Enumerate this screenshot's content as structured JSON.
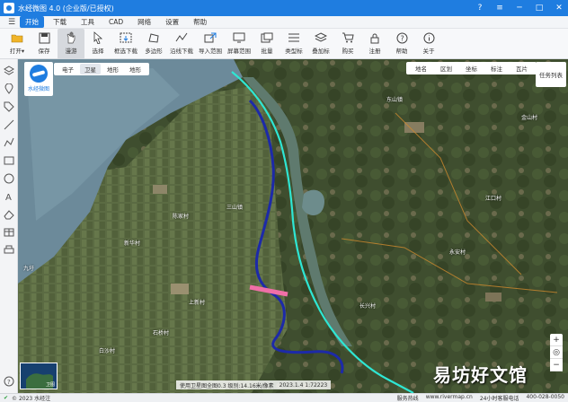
{
  "titlebar": {
    "title": "水经微图 4.0 (企业版/已授权)",
    "app_icon": "map-app-icon"
  },
  "menu": {
    "items": [
      "开始",
      "下载",
      "工具",
      "CAD",
      "网络",
      "设置",
      "帮助"
    ],
    "active": "开始"
  },
  "toolbar": {
    "items": [
      {
        "label": "打开▾",
        "icon": "folder-icon"
      },
      {
        "label": "保存",
        "icon": "save-icon"
      },
      {
        "label": "漫游",
        "icon": "hand-icon"
      },
      {
        "label": "选择",
        "icon": "pointer-icon"
      },
      {
        "label": "框选下载",
        "icon": "box-select-icon"
      },
      {
        "label": "多边形",
        "icon": "polygon-icon"
      },
      {
        "label": "沿线下载",
        "icon": "polyline-icon"
      },
      {
        "label": "导入范围",
        "icon": "import-icon"
      },
      {
        "label": "屏幕范围",
        "icon": "screen-icon"
      },
      {
        "label": "批量",
        "icon": "batch-icon"
      },
      {
        "label": "类型标",
        "icon": "type-icon"
      },
      {
        "label": "叠加标",
        "icon": "overlay-icon"
      },
      {
        "label": "购买",
        "icon": "cart-icon"
      },
      {
        "label": "注册",
        "icon": "lock-icon"
      },
      {
        "label": "帮助",
        "icon": "help-icon"
      },
      {
        "label": "关于",
        "icon": "info-icon"
      }
    ],
    "selected_index": 2
  },
  "map": {
    "logo_text": "水经微图",
    "maptype_tabs": [
      "电子",
      "卫星",
      "地形",
      "地形"
    ],
    "maptype_active_index": 1,
    "layer_tabs": [
      "地名",
      "区划",
      "坐标",
      "标注",
      "瓦片"
    ],
    "task_button": "任务列表",
    "zoom": {
      "in": "+",
      "out": "−"
    },
    "minimap_label": "卫图",
    "scale_text": "使用卫星图全图0.3  级别:14.16米/像素",
    "coords_text": "2023.1.4  1:72223",
    "places": [
      {
        "name": "三山镇"
      },
      {
        "name": "新华村"
      },
      {
        "name": "陈家村"
      },
      {
        "name": "九圩"
      },
      {
        "name": "石桥村"
      },
      {
        "name": "东山镇"
      },
      {
        "name": "江口村"
      },
      {
        "name": "永安村"
      },
      {
        "name": "上新村"
      },
      {
        "name": "金山村"
      },
      {
        "name": "长兴村"
      },
      {
        "name": "白沙村"
      }
    ],
    "watermark": "易坊好文馆"
  },
  "status": {
    "left": "© 2023 水经注",
    "service": "服务热线",
    "url": "www.rivermap.cn",
    "hours": "24小时客服电话",
    "phone": "400-028-0050"
  },
  "colors": {
    "titlebar": "#1f7de0",
    "route_blue": "#1d2aa8",
    "route_cyan": "#2ee6d4",
    "route_pink": "#f06fa7"
  }
}
